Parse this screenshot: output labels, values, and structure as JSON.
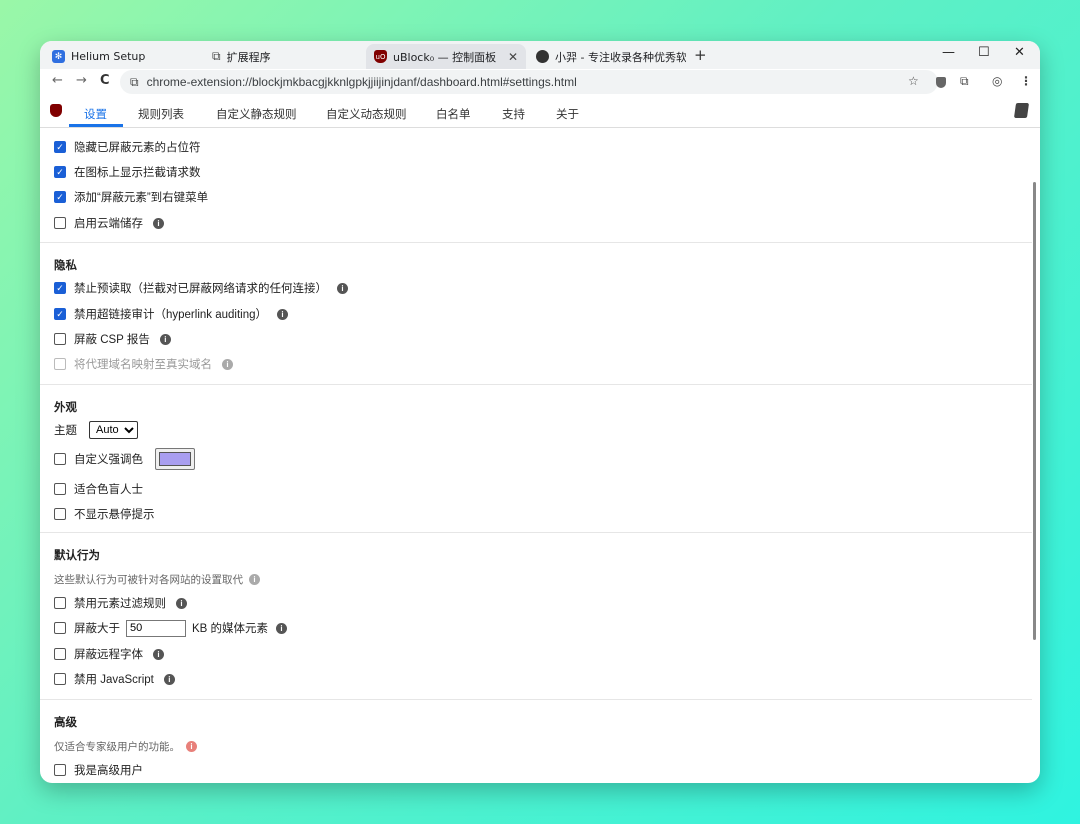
{
  "tabs": [
    {
      "label": "Helium Setup",
      "icon": "helium-icon"
    },
    {
      "label": "扩展程序",
      "icon": "puzzle-icon"
    },
    {
      "label": "uBlock₀ — 控制面板",
      "icon": "ublock-icon",
      "active": true
    },
    {
      "label": "小羿 - 专注收录各种优秀软件",
      "icon": "avatar-icon"
    }
  ],
  "window_controls": {
    "minimize": "—",
    "maximize": "☐",
    "close": "✕",
    "new_tab": "+",
    "tab_close": "✕"
  },
  "toolbar": {
    "back": "←",
    "forward": "→",
    "reload": "C",
    "url": "chrome-extension://blockjmkbacgjkknlgpkjjiijinjdanf/dashboard.html#settings.html"
  },
  "nav": [
    "设置",
    "规则列表",
    "自定义静态规则",
    "自定义动态规则",
    "白名单",
    "支持",
    "关于"
  ],
  "general": [
    {
      "label": "隐藏已屏蔽元素的占位符",
      "checked": true
    },
    {
      "label": "在图标上显示拦截请求数",
      "checked": true
    },
    {
      "label": "添加“屏蔽元素”到右键菜单",
      "checked": true
    },
    {
      "label": "启用云端储存",
      "checked": false
    }
  ],
  "privacy": {
    "heading": "隐私",
    "items": [
      {
        "label": "禁止预读取（拦截对已屏蔽网络请求的任何连接）",
        "checked": true
      },
      {
        "label": "禁用超链接审计（hyperlink auditing）",
        "checked": true
      },
      {
        "label": "屏蔽 CSP 报告",
        "checked": false
      },
      {
        "label": "将代理域名映射至真实域名",
        "checked": false
      }
    ]
  },
  "appearance": {
    "heading": "外观",
    "theme_label": "主题",
    "theme_value": "Auto",
    "accent_label": "自定义强调色",
    "accent_color": "#a99ef0",
    "colorblind_label": "适合色盲人士",
    "tooltips_label": "不显示悬停提示"
  },
  "default_behavior": {
    "heading": "默认行为",
    "subtitle": "这些默认行为可被针对各网站的设置取代",
    "filter_label": "禁用元素过滤规则",
    "media_prefix": "屏蔽大于",
    "media_value": "50",
    "media_suffix": "KB 的媒体元素",
    "fonts_label": "屏蔽远程字体",
    "js_label": "禁用 JavaScript"
  },
  "advanced": {
    "heading": "高级",
    "subtitle": "仅适合专家级用户的功能。",
    "advanced_user_label": "我是高级用户"
  }
}
